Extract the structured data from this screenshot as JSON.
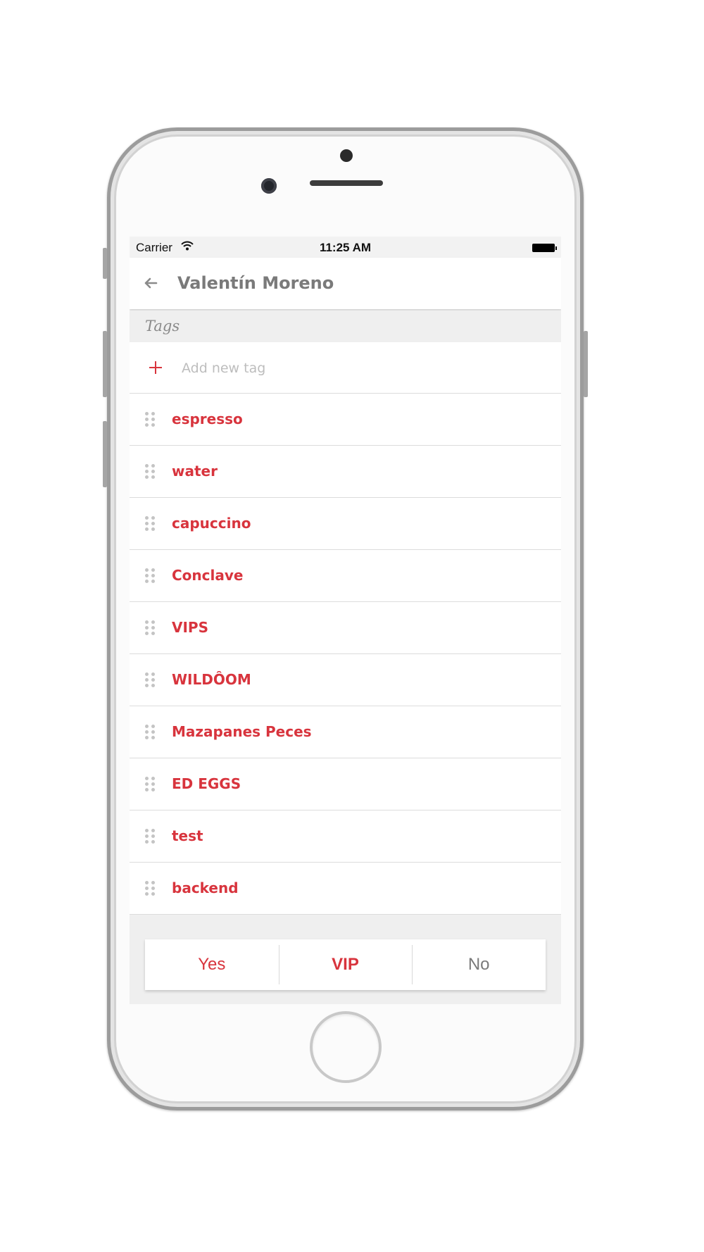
{
  "status_bar": {
    "carrier": "Carrier",
    "time": "11:25 AM"
  },
  "nav": {
    "title": "Valentín Moreno"
  },
  "section": {
    "title": "Tags"
  },
  "add_tag": {
    "placeholder": "Add new tag"
  },
  "tags": [
    "espresso",
    "water",
    "capuccino",
    "Conclave",
    "VIPS",
    "WILDÔOM",
    "Mazapanes Peces",
    "ED EGGS",
    "test",
    "backend"
  ],
  "segmented": {
    "yes": "Yes",
    "vip": "VIP",
    "no": "No",
    "selected": "VIP"
  },
  "colors": {
    "accent": "#d8343d",
    "muted": "#7a7a7a",
    "background": "#efefef"
  },
  "icons": [
    "wifi-icon",
    "battery-icon",
    "back-arrow-icon",
    "plus-icon",
    "drag-handle-icon"
  ]
}
